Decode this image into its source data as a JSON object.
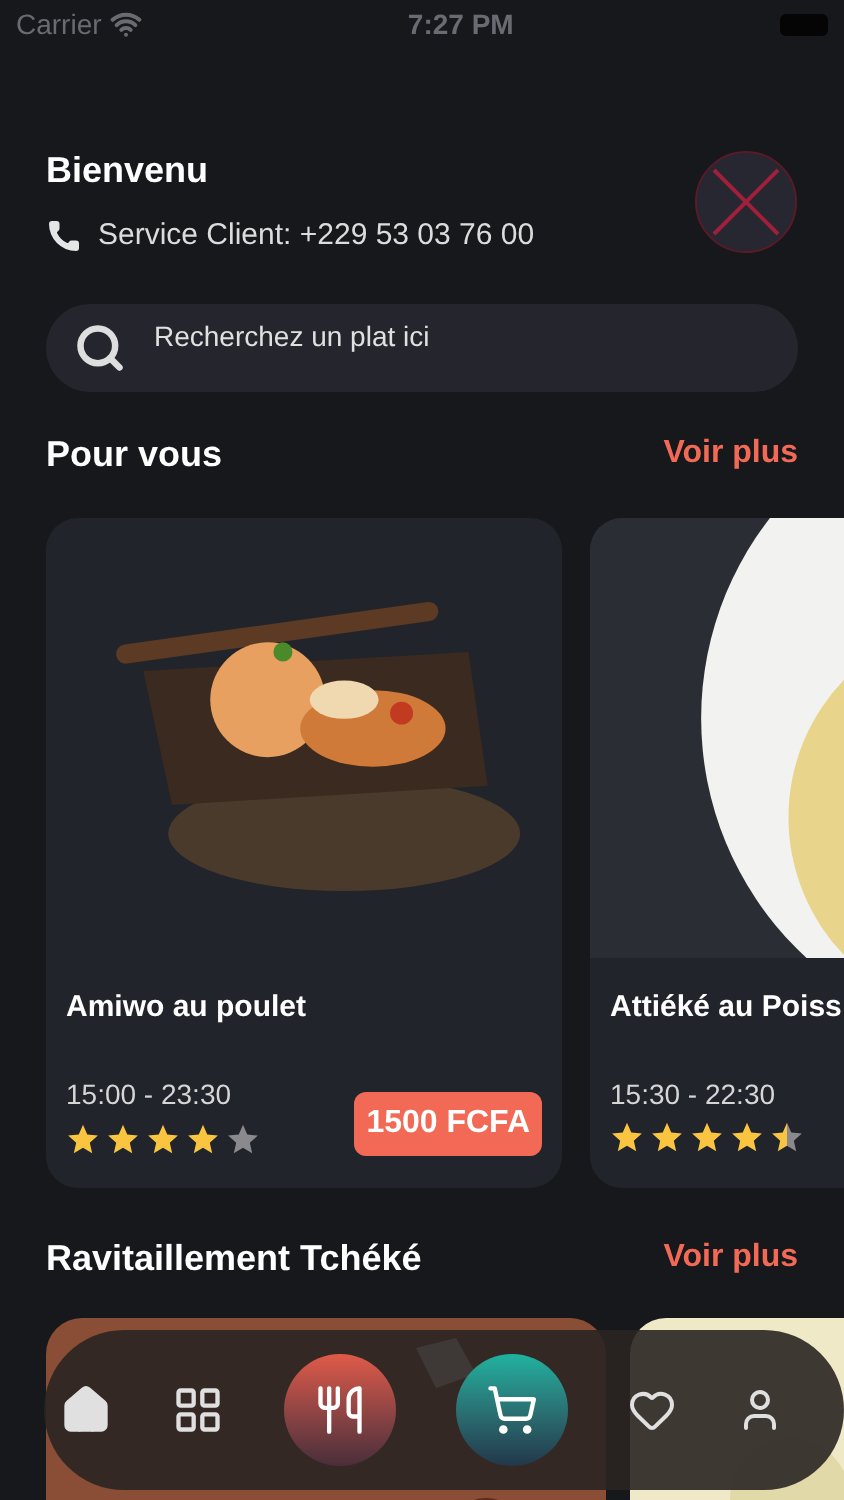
{
  "status_bar": {
    "carrier": "Carrier",
    "time": "7:27 PM"
  },
  "header": {
    "greeting": "Bienvenu",
    "service": "Service Client: +229 53 03 76 00"
  },
  "search": {
    "placeholder": "Recherchez un plat ici"
  },
  "pour_vous": {
    "title": "Pour vous",
    "more": "Voir plus",
    "cards": [
      {
        "kind": "picture",
        "name": "Amiwo au poulet",
        "hours": "15:00 - 23:30",
        "stars": 4,
        "price": "1500 FCFA"
      },
      {
        "kind": "picture",
        "name": "Attiéké au Poiss",
        "hours": "15:30 - 22:30",
        "stars": 4.5
      }
    ]
  },
  "ravitaillement": {
    "title": "Ravitaillement Tchéké",
    "more": "Voir plus"
  }
}
